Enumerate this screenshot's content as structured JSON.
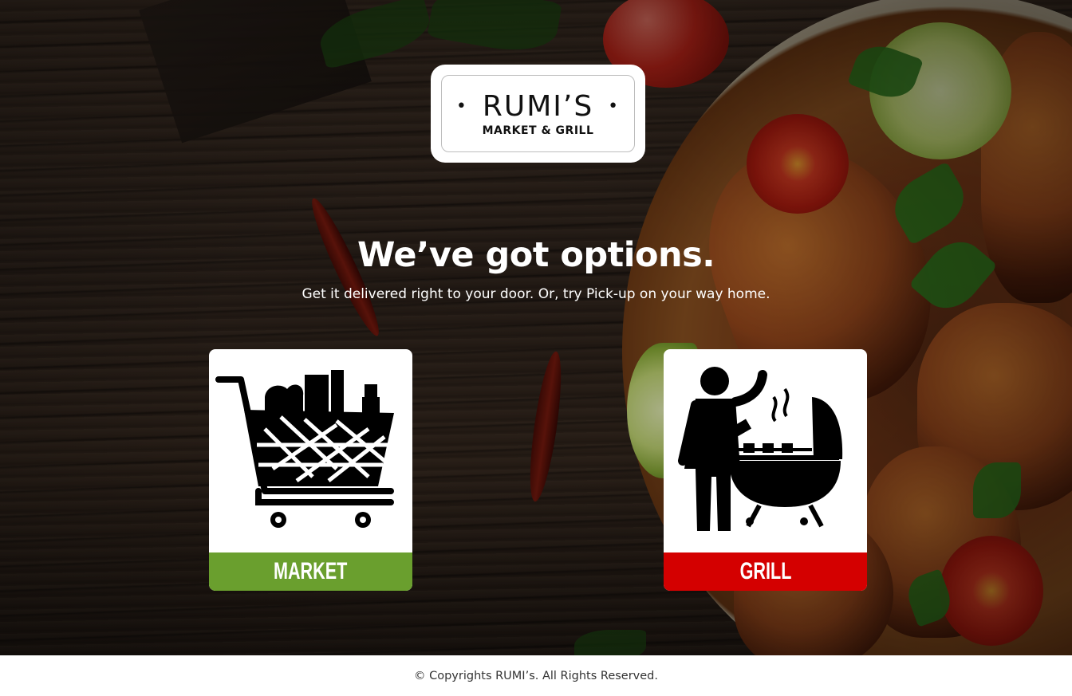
{
  "brand": {
    "name": "RUMI’S",
    "tagline": "MARKET & GRILL"
  },
  "hero": {
    "headline": "We’ve got options.",
    "subheadline": "Get it delivered right to your door. Or, try Pick-up on your way home."
  },
  "options": [
    {
      "label": "MARKET",
      "icon": "shopping-cart-icon",
      "color": "#6a9f2e"
    },
    {
      "label": "GRILL",
      "icon": "person-grilling-icon",
      "color": "#d40000"
    }
  ],
  "footer": {
    "copyright": "© Copyrights RUMI’s. All Rights Reserved."
  }
}
